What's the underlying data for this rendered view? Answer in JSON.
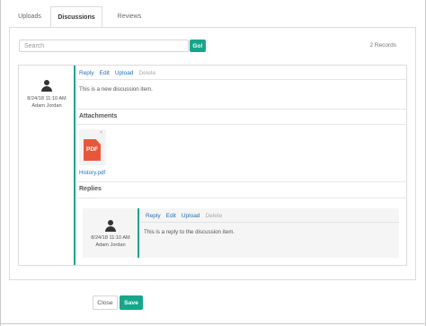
{
  "tabs": [
    {
      "label": "Uploads"
    },
    {
      "label": "Discussions"
    },
    {
      "label": "Reviews"
    }
  ],
  "search": {
    "placeholder": "Search",
    "go_label": "Go!"
  },
  "records_label": "2 Records",
  "discussion": {
    "date": "8/24/18 11:10 AM",
    "author": "Adam Jordan",
    "actions": {
      "reply": "Reply",
      "edit": "Edit",
      "upload": "Upload",
      "delete": "Delete"
    },
    "text": "This is a new discussion item.",
    "attachments_title": "Attachments",
    "attachment": {
      "icon_label": "PDF",
      "file_name": "History.pdf",
      "remove_glyph": "×"
    },
    "replies_title": "Replies"
  },
  "reply": {
    "date": "8/24/18 11:10 AM",
    "author": "Adam Jordan",
    "actions": {
      "reply": "Reply",
      "edit": "Edit",
      "upload": "Upload",
      "delete": "Delete"
    },
    "text": "This is a reply to the discussion item."
  },
  "footer": {
    "close_label": "Close",
    "save_label": "Save"
  },
  "colors": {
    "accent": "#17a689",
    "link": "#2a6fb4",
    "pdf": "#e8573c"
  }
}
